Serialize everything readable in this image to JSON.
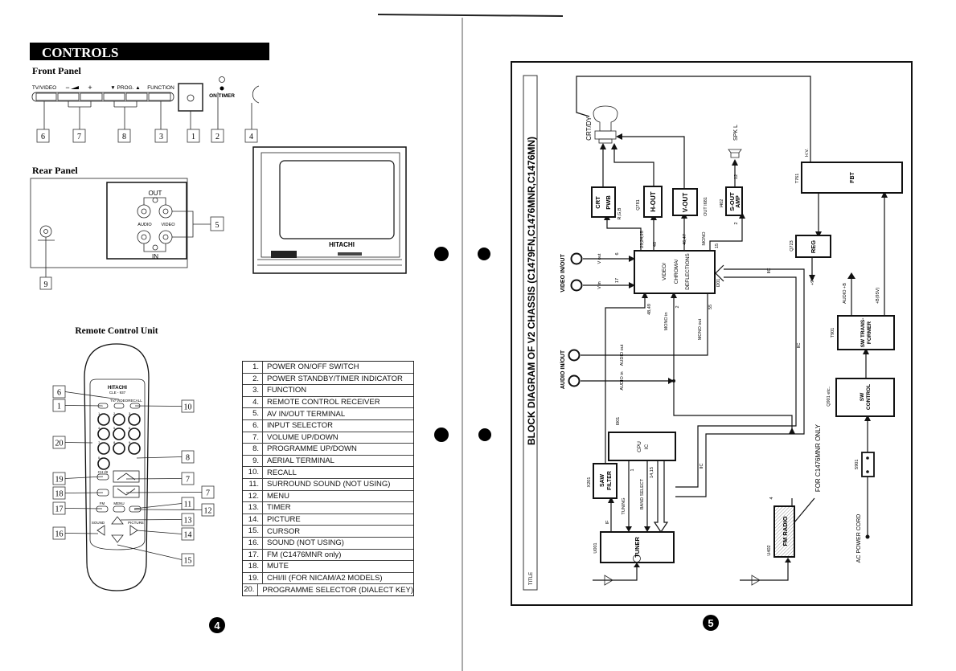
{
  "left_page": {
    "banner": "CONTROLS",
    "front_panel": {
      "heading": "Front Panel",
      "labels": {
        "tv_video": "TV/VIDEO",
        "minus": "−",
        "plus": "+",
        "prog": "▼ PROG. ▲",
        "function": "FUNCTION",
        "on_timer": "ON TIMER"
      },
      "callouts": [
        "6",
        "7",
        "8",
        "3",
        "1",
        "2",
        "4"
      ]
    },
    "rear_panel": {
      "heading": "Rear Panel",
      "out": "OUT",
      "in": "IN",
      "audio": "AUDIO",
      "video": "VIDEO",
      "callouts": [
        "5",
        "9"
      ]
    },
    "tv": {
      "brand": "HITACHI"
    },
    "remote": {
      "heading": "Remote Control Unit",
      "brand": "HITACHI",
      "model": "CLE - 937",
      "labels": {
        "tv_video": "TV/ VIDEO",
        "recall": "RECALL",
        "ch": "CH I/II",
        "fm": "FM",
        "menu": "MENU",
        "sound": "SOUND",
        "picture": "PICTURE"
      },
      "keys": [
        "1",
        "2",
        "3",
        "4",
        "5",
        "6",
        "7",
        "8",
        "9",
        "0"
      ],
      "callouts_left": [
        "6",
        "1",
        "20",
        "19",
        "18",
        "17",
        "16"
      ],
      "callouts_right": [
        "10",
        "8",
        "7",
        "7",
        "11",
        "12",
        "13",
        "14",
        "15"
      ]
    },
    "legend": [
      {
        "num": "1.",
        "text": "POWER ON/OFF SWITCH"
      },
      {
        "num": "2.",
        "text": "POWER STANDBY/TIMER INDICATOR"
      },
      {
        "num": "3.",
        "text": "FUNCTION"
      },
      {
        "num": "4.",
        "text": "REMOTE CONTROL RECEIVER"
      },
      {
        "num": "5.",
        "text": "AV IN/OUT TERMINAL"
      },
      {
        "num": "6.",
        "text": "INPUT SELECTOR"
      },
      {
        "num": "7.",
        "text": "VOLUME UP/DOWN"
      },
      {
        "num": "8.",
        "text": "PROGRAMME UP/DOWN"
      },
      {
        "num": "9.",
        "text": "AERIAL TERMINAL"
      },
      {
        "num": "10.",
        "text": "RECALL"
      },
      {
        "num": "11.",
        "text": "SURROUND SOUND (NOT USING)"
      },
      {
        "num": "12.",
        "text": "MENU"
      },
      {
        "num": "13.",
        "text": "TIMER"
      },
      {
        "num": "14.",
        "text": "PICTURE"
      },
      {
        "num": "15.",
        "text": "CURSOR"
      },
      {
        "num": "16.",
        "text": "SOUND (NOT USING)"
      },
      {
        "num": "17.",
        "text": "FM (C1476MNR only)"
      },
      {
        "num": "18.",
        "text": "MUTE"
      },
      {
        "num": "19.",
        "text": "CHI/II (FOR NICAM/A2 MODELS)"
      },
      {
        "num": "20.",
        "text": "PROGRAMME SELECTOR (DIALECT KEY)"
      }
    ],
    "page_number": "4"
  },
  "right_page": {
    "title": "BLOCK DIAGRAM OF V2 CHASSIS (C1479FN,C1476MNR,C1476MN)",
    "title_label": "TITLE",
    "blocks": {
      "crt_pwb": [
        "CRT",
        "PWB"
      ],
      "h_out": "H-OUT",
      "v_out": "V-OUT",
      "s_out_amp": [
        "S-OUT",
        "AMP"
      ],
      "fbt": "FBT",
      "reg": "REG",
      "main_ic": [
        "VIDEO/",
        "CHROMA/",
        "DEFLECTIONS"
      ],
      "cpu": [
        "CPU",
        "IC"
      ],
      "saw": [
        "SAW",
        "FILTER"
      ],
      "tuner": "TUNER",
      "fm_radio": "FM RADIO",
      "sw_transformer": [
        "SW TRANS-",
        "FORMER"
      ],
      "sw_control": [
        "SW",
        "CONTROL"
      ]
    },
    "refs": {
      "q781": "Q781",
      "out_i681": "OUT I681",
      "i402": "I402",
      "t761": "T761",
      "q723": "Q723",
      "i201": "I201",
      "i001": "I001",
      "x201": "X201",
      "u001": "U001",
      "u402": "U402",
      "t901": "T901",
      "q901": "Q901 etc..",
      "s901": "S901"
    },
    "labels": {
      "crt_dy": "CRT/DY",
      "spk_l": "SPK L",
      "hv": "H.V.",
      "plus9v": "+9V",
      "rgb": "R,G,B",
      "pins_rgb": "23,24,25",
      "pin_40": "40",
      "pins_46_47": "46,47",
      "mono": "MONO",
      "pin_15": "15",
      "pin_12": "12",
      "pin_2_amp": "2",
      "video_io": "VIDEO IN/OUT",
      "v_out": "V out",
      "v_in": "V in",
      "pin_6": "6",
      "pin_17": "17",
      "audio_io": "AUDIO IN/OUT",
      "audio_out": "AUDIO out",
      "audio_in": "AUDIO in",
      "pins_48_49": "48,49",
      "mono_in": "MONO in",
      "pin_2": "2",
      "mono_out": "MONO out",
      "pin_55": "55",
      "iic": "IIC",
      "iic2": "IIC",
      "iic3": "IIC",
      "tuning": "TUNING",
      "band_select": "BAND SELECT",
      "pin_1": "1",
      "pins_14_15": "14,15",
      "if": "IF",
      "fm_pin_4": "4",
      "fm_only": "FOR C1476MNR ONLY",
      "audio_b": "AUDIO +B",
      "b95": "+B(95V)",
      "ac_cord": "AC POWER CORD"
    },
    "page_number": "5"
  }
}
